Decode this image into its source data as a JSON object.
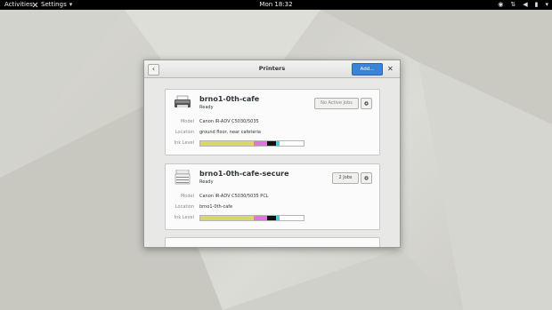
{
  "topbar": {
    "activities": "Activities",
    "app_menu": "Settings",
    "clock": "Mon 18:32"
  },
  "dialog": {
    "title": "Printers",
    "add_label": "Add..."
  },
  "labels": {
    "model": "Model",
    "location": "Location",
    "ink": "Ink Level"
  },
  "printers": [
    {
      "name": "brno1-0th-cafe",
      "status": "Ready",
      "jobs_label": "No Active Jobs",
      "model": "Canon iR-ADV C5030/5035",
      "location": "ground floor, near cafeteria",
      "ink": [
        {
          "color": "#d8d86a",
          "level": 0.52
        },
        {
          "color": "#e272e0",
          "level": 0.13
        },
        {
          "color": "#111111",
          "level": 0.08
        },
        {
          "color": "#49d0dd",
          "level": 0.04
        }
      ]
    },
    {
      "name": "brno1-0th-cafe-secure",
      "status": "Ready",
      "jobs_label": "2 Jobs",
      "model": "Canon iR-ADV C5030/5035 PCL",
      "location": "brno1-0th-cafe",
      "ink": [
        {
          "color": "#d8d86a",
          "level": 0.52
        },
        {
          "color": "#e272e0",
          "level": 0.13
        },
        {
          "color": "#111111",
          "level": 0.08
        },
        {
          "color": "#49d0dd",
          "level": 0.04
        }
      ]
    }
  ]
}
